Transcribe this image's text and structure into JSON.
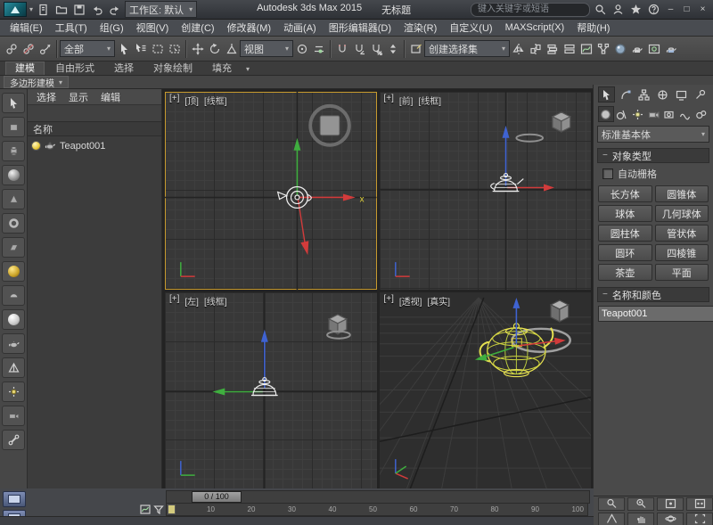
{
  "titlebar": {
    "workspace": "工作区: 默认",
    "app_title": "Autodesk 3ds Max  2015",
    "doc_title": "无标题",
    "search_placeholder": "键入关键字或短语",
    "window": {
      "minimize": "–",
      "maximize": "□",
      "close": "×"
    }
  },
  "menubar": {
    "items": [
      "编辑(E)",
      "工具(T)",
      "组(G)",
      "视图(V)",
      "创建(C)",
      "修改器(M)",
      "动画(A)",
      "图形编辑器(D)",
      "渲染(R)",
      "自定义(U)",
      "MAXScript(X)",
      "帮助(H)"
    ]
  },
  "toolbar": {
    "selection_filter": "全部",
    "reference_coord": "视图",
    "named_selection_placeholder": "创建选择集"
  },
  "ribbon": {
    "tabs": [
      "建模",
      "自由形式",
      "选择",
      "对象绘制",
      "填充"
    ],
    "panel_label": "多边形建模"
  },
  "scene_explorer": {
    "menus": [
      "选择",
      "显示",
      "编辑"
    ],
    "name_header": "名称",
    "items": [
      {
        "name": "Teapot001"
      }
    ]
  },
  "viewports": {
    "top": {
      "menu": "[+]",
      "view": "[顶]",
      "shading": "[线框]"
    },
    "front": {
      "menu": "[+]",
      "view": "[前]",
      "shading": "[线框]"
    },
    "left": {
      "menu": "[+]",
      "view": "[左]",
      "shading": "[线框]"
    },
    "persp": {
      "menu": "[+]",
      "view": "[透视]",
      "shading": "[真实]"
    },
    "axis_x_label": "x"
  },
  "command_panel": {
    "category_dropdown": "标准基本体",
    "object_type": {
      "title": "对象类型",
      "autogrid": "自动栅格",
      "buttons": [
        "长方体",
        "圆锥体",
        "球体",
        "几何球体",
        "圆柱体",
        "管状体",
        "圆环",
        "四棱锥",
        "茶壶",
        "平面"
      ]
    },
    "name_color": {
      "title": "名称和颜色",
      "name": "Teapot001",
      "color": "#ad9023"
    }
  },
  "timeline": {
    "frame_display": "0 / 100",
    "ticks": [
      "0",
      "10",
      "20",
      "30",
      "40",
      "50",
      "60",
      "70",
      "80",
      "90",
      "100"
    ]
  },
  "colors": {
    "active_viewport_border": "#c79a2e",
    "gizmo_x": "#d23b3b",
    "gizmo_y": "#3fae3f",
    "gizmo_z": "#3f63d2",
    "selected_wireframe": "#e6e150"
  }
}
